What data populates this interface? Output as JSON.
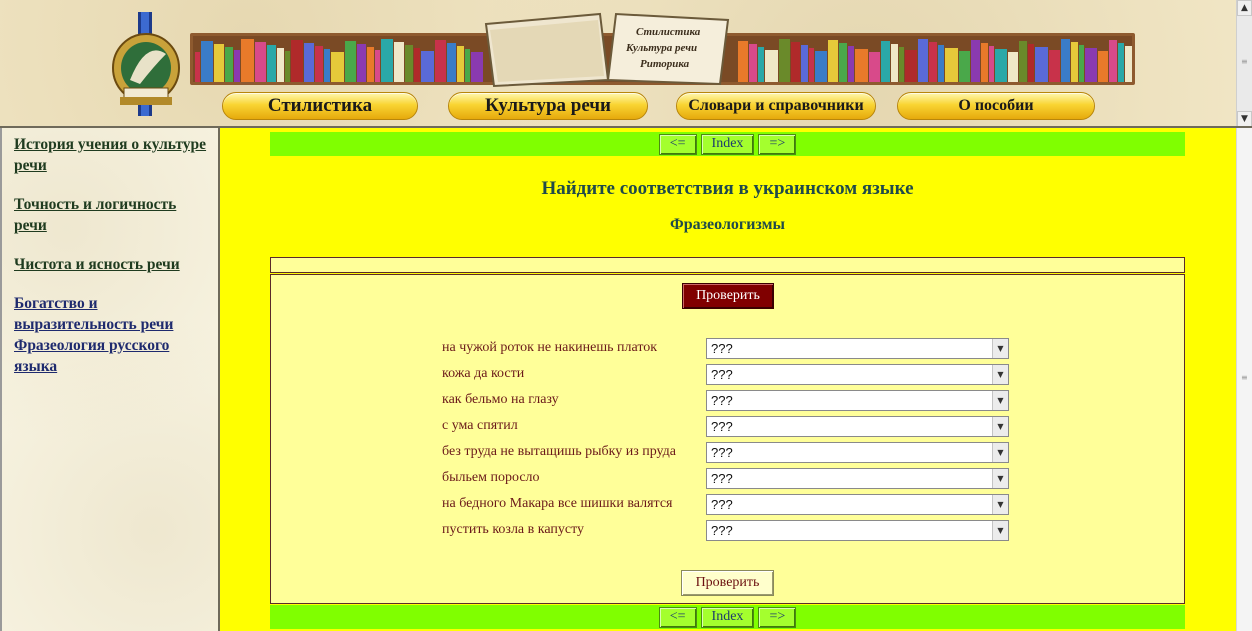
{
  "header": {
    "book_lines": [
      "Стилистика",
      "Культура речи",
      "Риторика"
    ],
    "nav": [
      {
        "label": "Стилистика"
      },
      {
        "label": "Культура речи"
      },
      {
        "label": "Словари и справочники"
      },
      {
        "label": "О пособии"
      }
    ]
  },
  "sidebar": {
    "links": [
      {
        "label": "История учения о культуре речи"
      },
      {
        "label": "Точность и логичность речи"
      },
      {
        "label": "Чистота и ясность речи"
      },
      {
        "label": "Богатство и выразительность речи"
      },
      {
        "label": "Фразеология русского языка"
      }
    ]
  },
  "main": {
    "nav": {
      "prev": "<=",
      "index": "Index",
      "next": "=>"
    },
    "title": "Найдите соответствия в украинском языке",
    "subtitle": "Фразеологизмы",
    "check_button": "Проверить",
    "select_default": "???",
    "questions": [
      "на чужой роток не накинешь платок",
      "кожа да кости",
      "как бельмо на глазу",
      "с ума спятил",
      "без труда не вытащишь рыбку из пруда",
      "быльем поросло",
      "на бедного Макара все шишки валятся",
      "пустить козла в капусту"
    ]
  },
  "colors": {
    "main_bg": "#ffff00",
    "navbar_bg": "#80ff00",
    "quiz_bg": "#ffff99",
    "check_button_bg": "#800000"
  }
}
